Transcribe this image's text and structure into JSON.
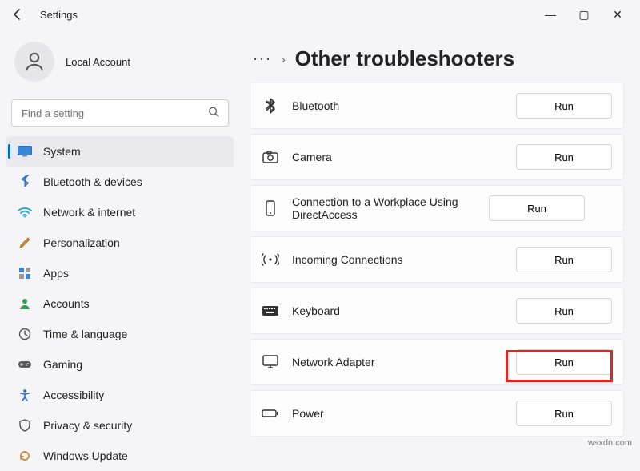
{
  "window": {
    "title": "Settings",
    "min": "—",
    "max": "▢",
    "close": "✕"
  },
  "account": {
    "name": "Local Account"
  },
  "search": {
    "placeholder": "Find a setting"
  },
  "nav": {
    "system": "System",
    "bluetooth": "Bluetooth & devices",
    "network": "Network & internet",
    "personalization": "Personalization",
    "apps": "Apps",
    "accounts": "Accounts",
    "time": "Time & language",
    "gaming": "Gaming",
    "accessibility": "Accessibility",
    "privacy": "Privacy & security",
    "update": "Windows Update"
  },
  "header": {
    "ellipsis": "···",
    "chevron": "›",
    "title": "Other troubleshooters"
  },
  "items": {
    "bluetooth": {
      "label": "Bluetooth",
      "run": "Run"
    },
    "camera": {
      "label": "Camera",
      "run": "Run"
    },
    "workplace": {
      "label": "Connection to a Workplace Using DirectAccess",
      "run": "Run"
    },
    "incoming": {
      "label": "Incoming Connections",
      "run": "Run"
    },
    "keyboard": {
      "label": "Keyboard",
      "run": "Run"
    },
    "netadapter": {
      "label": "Network Adapter",
      "run": "Run"
    },
    "power": {
      "label": "Power",
      "run": "Run"
    }
  },
  "watermark": "wsxdn.com"
}
